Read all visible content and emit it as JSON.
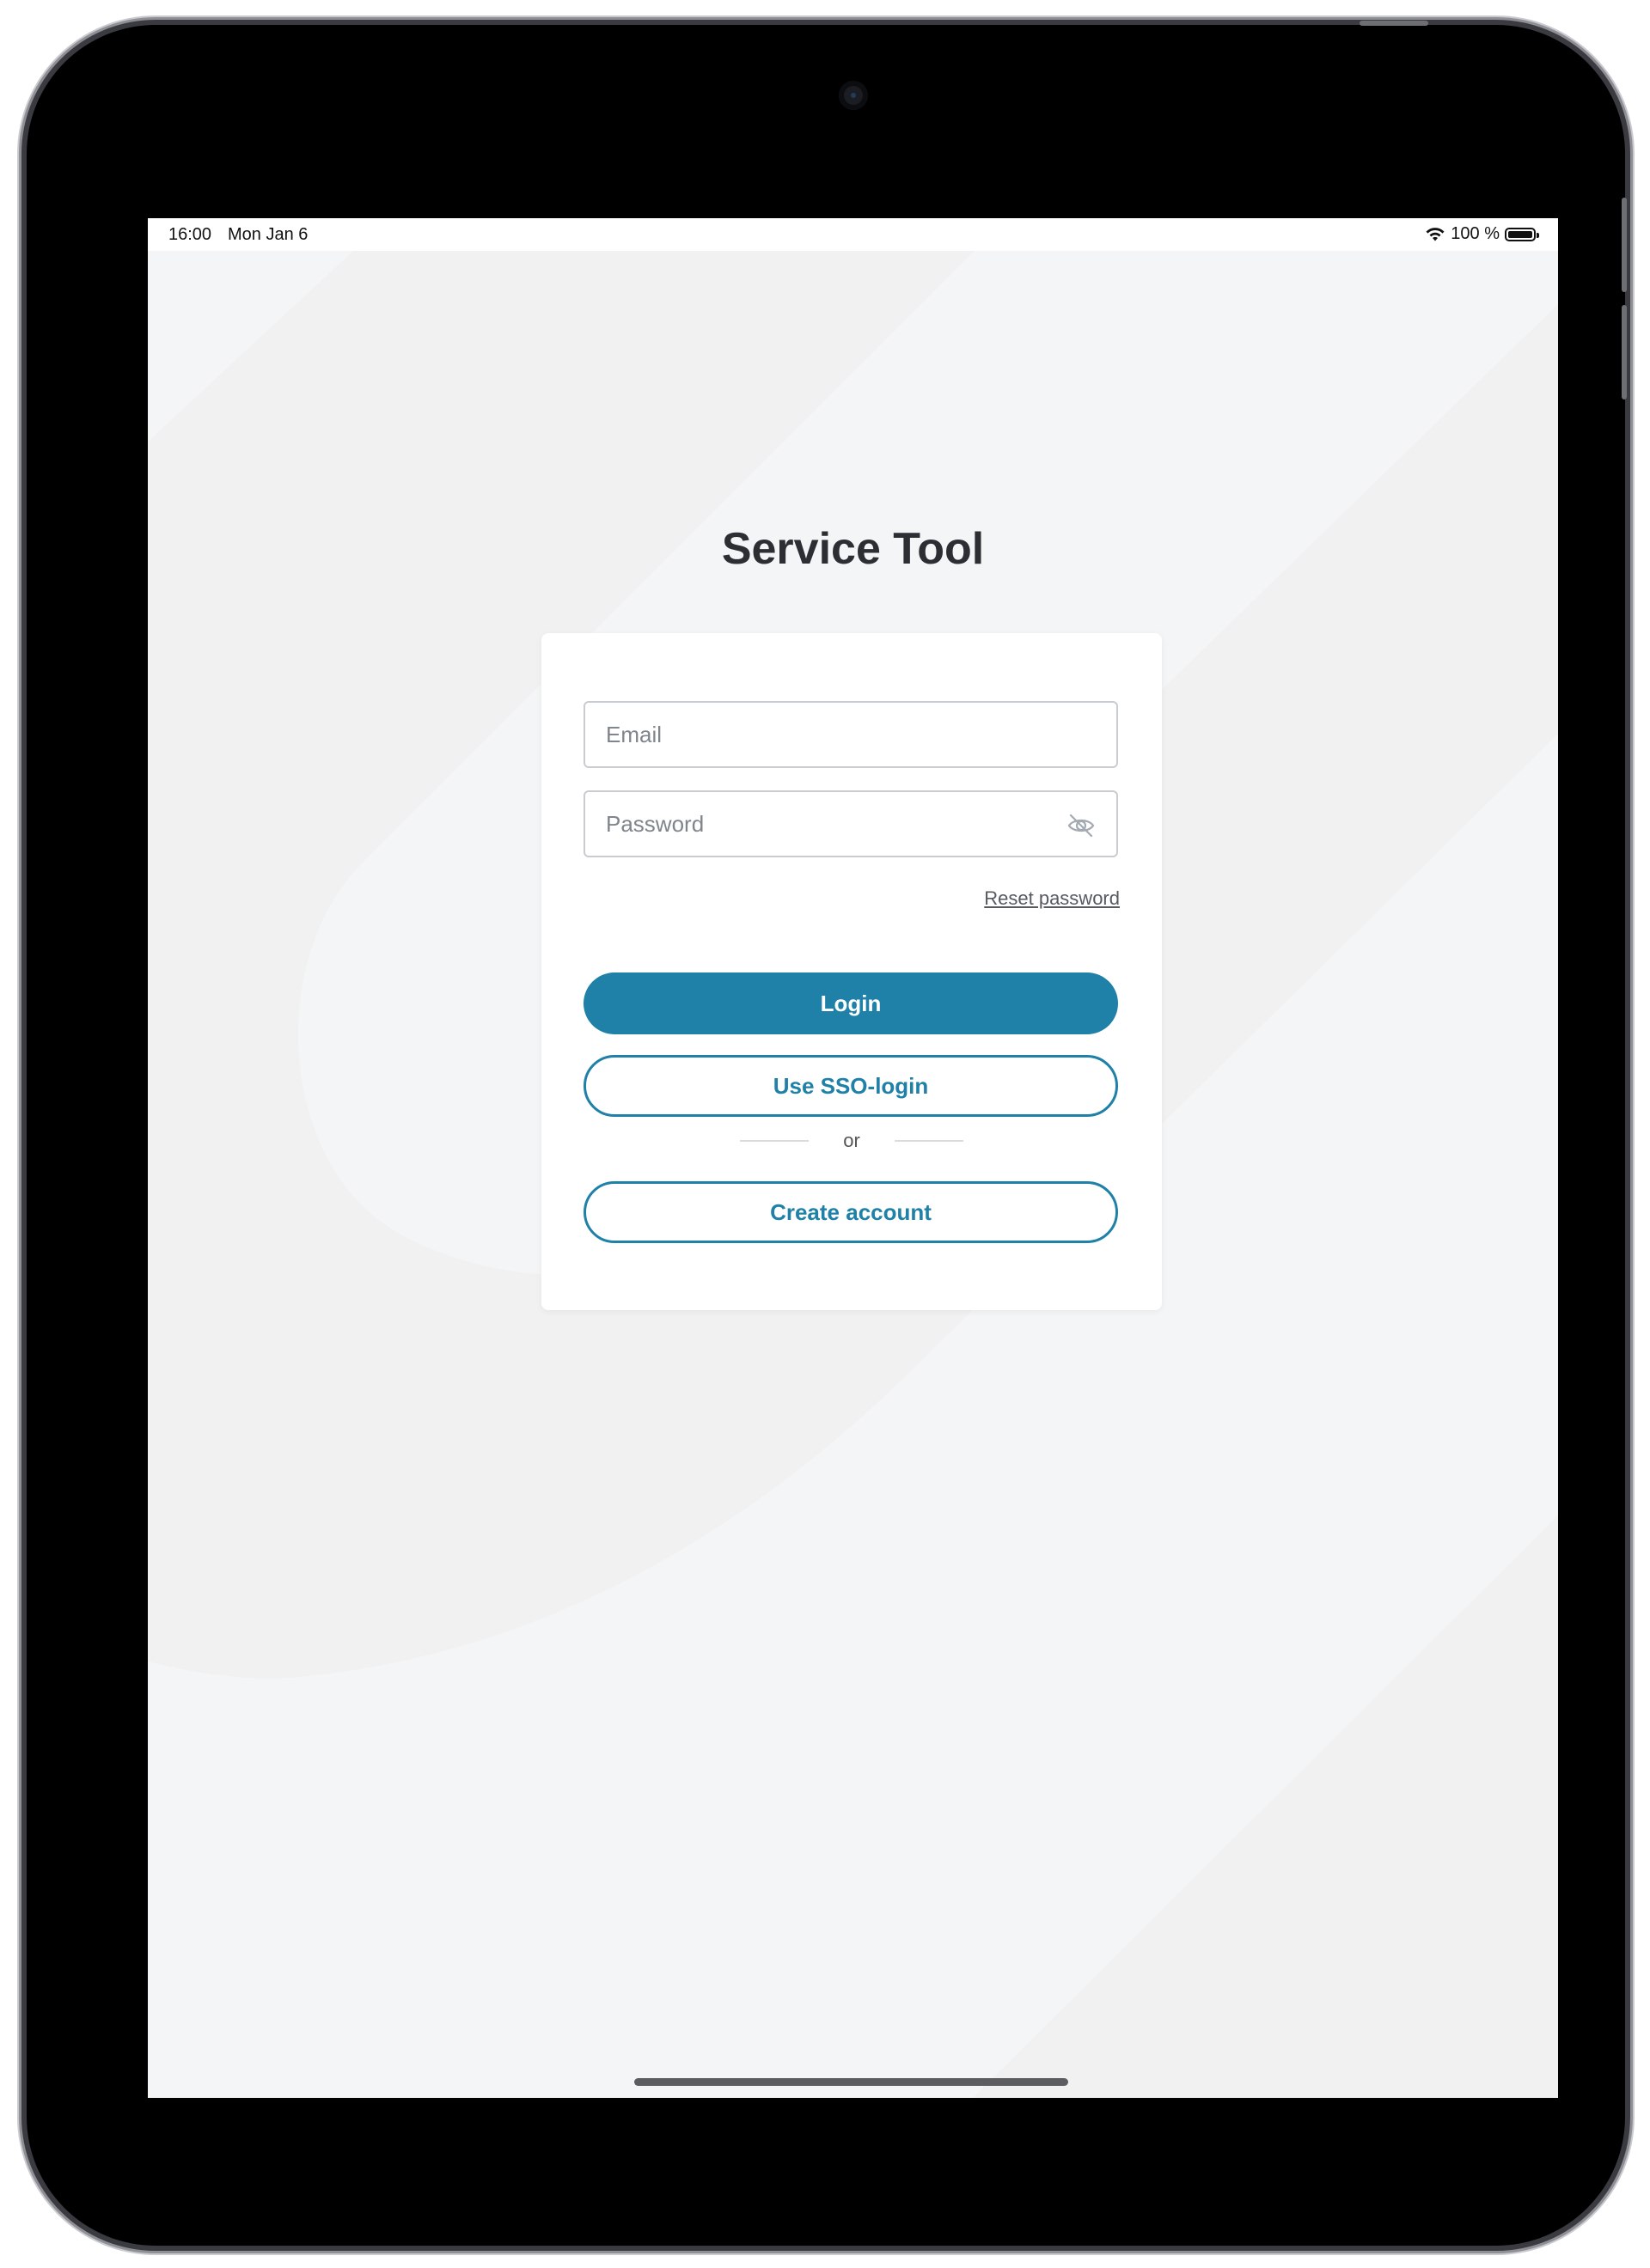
{
  "status_bar": {
    "time": "16:00",
    "date": "Mon Jan 6",
    "battery_percent": "100 %"
  },
  "app": {
    "title": "Service Tool"
  },
  "login_form": {
    "email_placeholder": "Email",
    "email_value": "",
    "password_placeholder": "Password",
    "password_value": "",
    "reset_password": "Reset password",
    "login_button": "Login",
    "sso_button": "Use SSO-login",
    "divider_text": "or",
    "create_account_button": "Create account"
  },
  "colors": {
    "accent": "#1f80a8",
    "background": "#f4f5f6",
    "title": "#2d2e33"
  },
  "icons": {
    "password_toggle": "eye-slash-icon",
    "wifi": "wifi-icon",
    "battery": "battery-icon"
  }
}
